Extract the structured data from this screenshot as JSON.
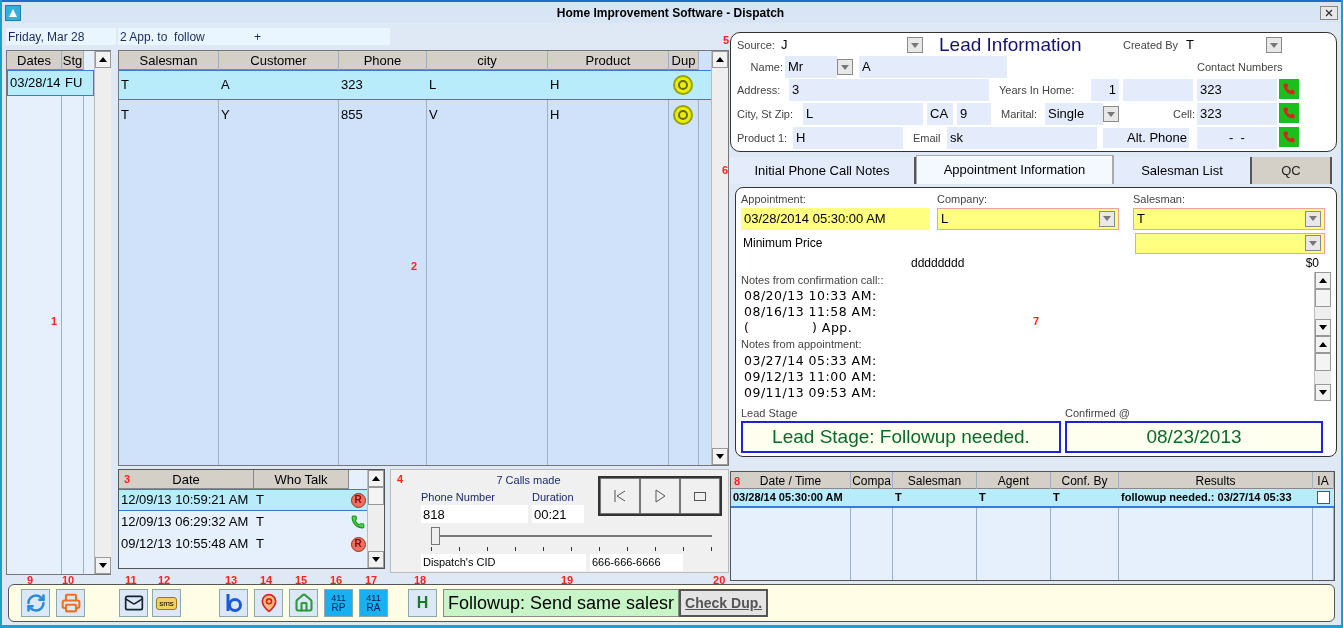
{
  "window": {
    "title": "Home Improvement Software - Dispatch"
  },
  "header": {
    "date": "Friday, Mar 28",
    "summary": "2 App. to  follow",
    "extra": "+"
  },
  "dates_grid": {
    "marker": "1",
    "columns": [
      "Dates",
      "Stg"
    ],
    "rows": [
      {
        "cells": [
          "03/28/14",
          "FU"
        ],
        "selected": true
      }
    ]
  },
  "main_grid": {
    "marker": "2",
    "columns": [
      "Salesman",
      "Customer",
      "Phone",
      "city",
      "Product",
      "Dup"
    ],
    "rows": [
      {
        "cells": [
          "T",
          "A",
          "323",
          "L",
          "H"
        ],
        "duplicate": true,
        "selected": true
      },
      {
        "cells": [
          "T",
          "Y",
          "855",
          "V",
          "H"
        ],
        "duplicate": true,
        "selected": false
      }
    ]
  },
  "calls": {
    "marker": "3",
    "columns": [
      "Date",
      "Who Talk"
    ],
    "rows": [
      {
        "date": "12/09/13 10:59:21 AM",
        "who": "T",
        "kind": "recording",
        "badge": "R",
        "selected": true
      },
      {
        "date": "12/09/13 06:29:32 AM",
        "who": "T",
        "kind": "call",
        "selected": false
      },
      {
        "date": "09/12/13 10:55:48 AM",
        "who": "T",
        "kind": "recording",
        "badge": "R",
        "selected": false
      }
    ]
  },
  "player": {
    "marker": "4",
    "calls_made": "7 Calls made",
    "phone_label": "Phone Number",
    "phone": "818",
    "duration_label": "Duration",
    "duration": "00:21",
    "level": 0.0,
    "cid_label": "Dispatch's CID",
    "cid": "666-666-6666"
  },
  "lead": {
    "marker": "5",
    "title": "Lead Information",
    "source": {
      "label": "Source:",
      "value": "J"
    },
    "created_by": {
      "label": "Created By",
      "value": "T"
    },
    "name": {
      "label": "Name:",
      "prefix": "Mr",
      "value": "A"
    },
    "contact_label": "Contact Numbers",
    "address": {
      "label": "Address:",
      "value": "3"
    },
    "years": {
      "label": "Years In Home:",
      "value": "1"
    },
    "city": {
      "label": "City, St Zip:",
      "city": "L",
      "state": "CA",
      "zip": "9"
    },
    "marital": {
      "label": "Marital:",
      "value": "Single"
    },
    "product": {
      "label": "Product 1:",
      "value": "H"
    },
    "email": {
      "label": "Email",
      "value": "sk"
    },
    "phones": [
      {
        "value": "323"
      },
      {
        "label": "Cell:",
        "value": "323"
      },
      {
        "label": "Alt. Phone",
        "value": "-  -"
      }
    ]
  },
  "tabs": {
    "marker": "6",
    "items": [
      {
        "label": "Initial Phone Call Notes",
        "selected": false,
        "disabled": false
      },
      {
        "label": "Appointment Information",
        "selected": true,
        "disabled": false
      },
      {
        "label": "Salesman List",
        "selected": false,
        "disabled": false
      },
      {
        "label": "QC",
        "selected": false,
        "disabled": true
      }
    ]
  },
  "appointment": {
    "marker": "7",
    "appointment": {
      "label": "Appointment:",
      "value": "03/28/2014 05:30:00 AM"
    },
    "company": {
      "label": "Company:",
      "value": "L"
    },
    "salesman": {
      "label": "Salesman:",
      "value": "T"
    },
    "min_price": {
      "label": "Minimum Price"
    },
    "description": "dddddddd",
    "price": "$0",
    "confirmation_notes": {
      "label": "Notes from confirmation call::",
      "lines": [
        "08/20/13 10:33 AM:",
        "08/16/13 11:58 AM:",
        "(              ) App."
      ]
    },
    "appointment_notes": {
      "label": "Notes from appointment:",
      "lines": [
        "03/27/14 05:33 AM:",
        "09/12/13 11:00 AM:",
        "09/11/13 09:53 AM:"
      ]
    },
    "lead_stage": {
      "label": "Lead Stage",
      "value": "Lead Stage: Followup needed."
    },
    "confirmed": {
      "label": "Confirmed @",
      "value": "08/23/2013"
    }
  },
  "history": {
    "marker": "8",
    "columns": [
      "Date / Time",
      "Compa",
      "Salesman",
      "Agent",
      "Conf. By",
      "Results",
      "IA"
    ],
    "rows": [
      {
        "cells": [
          "03/28/14 05:30:00 AM",
          "",
          "T",
          "T",
          "T",
          "followup needed.: 03/27/14 05:33"
        ],
        "ia_checked": false,
        "selected": true
      }
    ]
  },
  "toolbar": {
    "items": [
      {
        "marker": "9",
        "kind": "refresh"
      },
      {
        "marker": "10",
        "kind": "print"
      },
      {
        "marker": "11",
        "kind": "email"
      },
      {
        "marker": "12",
        "kind": "sms",
        "label": "sms"
      },
      {
        "marker": "13",
        "kind": "b-logo"
      },
      {
        "marker": "14",
        "kind": "map"
      },
      {
        "marker": "15",
        "kind": "house"
      },
      {
        "marker": "16",
        "kind": "tile",
        "label": "411",
        "sub": "RP"
      },
      {
        "marker": "17",
        "kind": "tile",
        "label": "411",
        "sub": "RA"
      },
      {
        "marker": "18",
        "kind": "letter",
        "label": "H"
      }
    ],
    "status": {
      "marker": "19",
      "text": "Followup: Send same salesr"
    },
    "check_dup": {
      "marker": "20",
      "label": "Check Dup."
    }
  }
}
